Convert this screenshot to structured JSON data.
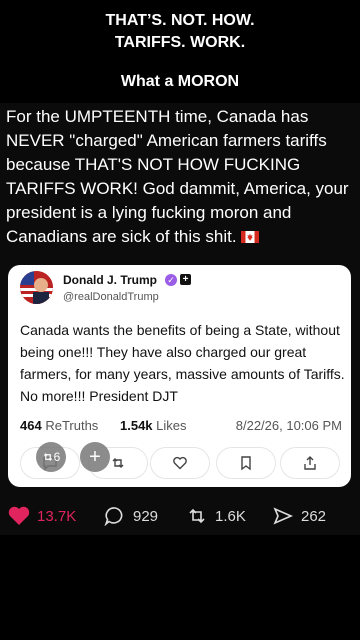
{
  "caption": {
    "line1": "THAT’S. NOT. HOW.",
    "line2": "TARIFFS. WORK.",
    "line3": "What a MORON"
  },
  "post": {
    "text": "For the UMPTEENTH time, Canada has NEVER \"charged\" American farmers tariffs because THAT'S NOT HOW FUCKING TARIFFS WORK! God dammit, America, your president is a lying fucking moron and Canadians are sick of this shit.",
    "flag_icon": "canada-flag-icon"
  },
  "truth_card": {
    "display_name": "Donald J. Trump",
    "handle": "@realDonaldTrump",
    "text": "Canada wants the benefits of being a State, without being one!!! They have also charged our great farmers, for many years, massive amounts of Tariffs. No more!!! President DJT",
    "retruths_count": "464",
    "retruths_label": "ReTruths",
    "likes_count": "1.54k",
    "likes_label": "Likes",
    "timestamp": "8/22/26, 10:06 PM",
    "overlay_count": "6",
    "actions": [
      "reply-icon",
      "retruth-icon",
      "like-icon",
      "bookmark-icon",
      "share-icon"
    ]
  },
  "engagement": {
    "likes": "13.7K",
    "comments": "929",
    "reposts": "1.6K",
    "shares": "262",
    "colors": {
      "like": "#e0245e",
      "text": "#ffffff"
    }
  }
}
